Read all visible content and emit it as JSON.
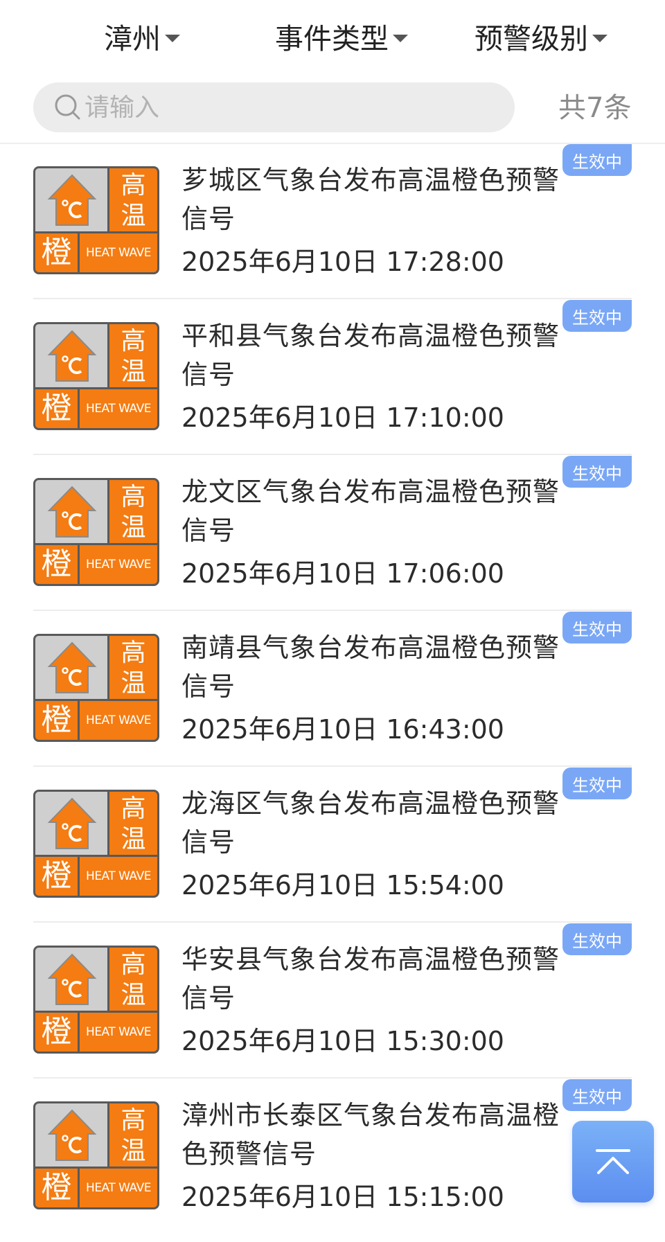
{
  "filters": {
    "city": "漳州",
    "event_type": "事件类型",
    "warning_level": "预警级别"
  },
  "search": {
    "placeholder": "请输入",
    "value": "",
    "total_label": "共7条"
  },
  "icon_text": {
    "top_label": "高\n温",
    "level_char": "橙",
    "english_label": "HEAT WAVE"
  },
  "alerts": [
    {
      "title": "芗城区气象台发布高温橙色预警信号",
      "time": "2025年6月10日 17:28:00",
      "status": "生效中"
    },
    {
      "title": "平和县气象台发布高温橙色预警信号",
      "time": "2025年6月10日 17:10:00",
      "status": "生效中"
    },
    {
      "title": "龙文区气象台发布高温橙色预警信号",
      "time": "2025年6月10日 17:06:00",
      "status": "生效中"
    },
    {
      "title": "南靖县气象台发布高温橙色预警信号",
      "time": "2025年6月10日 16:43:00",
      "status": "生效中"
    },
    {
      "title": "龙海区气象台发布高温橙色预警信号",
      "time": "2025年6月10日 15:54:00",
      "status": "生效中"
    },
    {
      "title": "华安县气象台发布高温橙色预警信号",
      "time": "2025年6月10日 15:30:00",
      "status": "生效中"
    },
    {
      "title": "漳州市长泰区气象台发布高温橙色预警信号",
      "time": "2025年6月10日 15:15:00",
      "status": "生效中"
    }
  ],
  "colors": {
    "badge_blue": "#7aa7f5",
    "warning_orange": "#f47c12",
    "back_to_top_blue": "#5c8ef0"
  },
  "icons": {
    "search": "search-icon",
    "dropdown": "caret-down-icon",
    "back_to_top": "arrow-up-to-top-icon",
    "warning": "heat-wave-orange-warning-icon"
  }
}
